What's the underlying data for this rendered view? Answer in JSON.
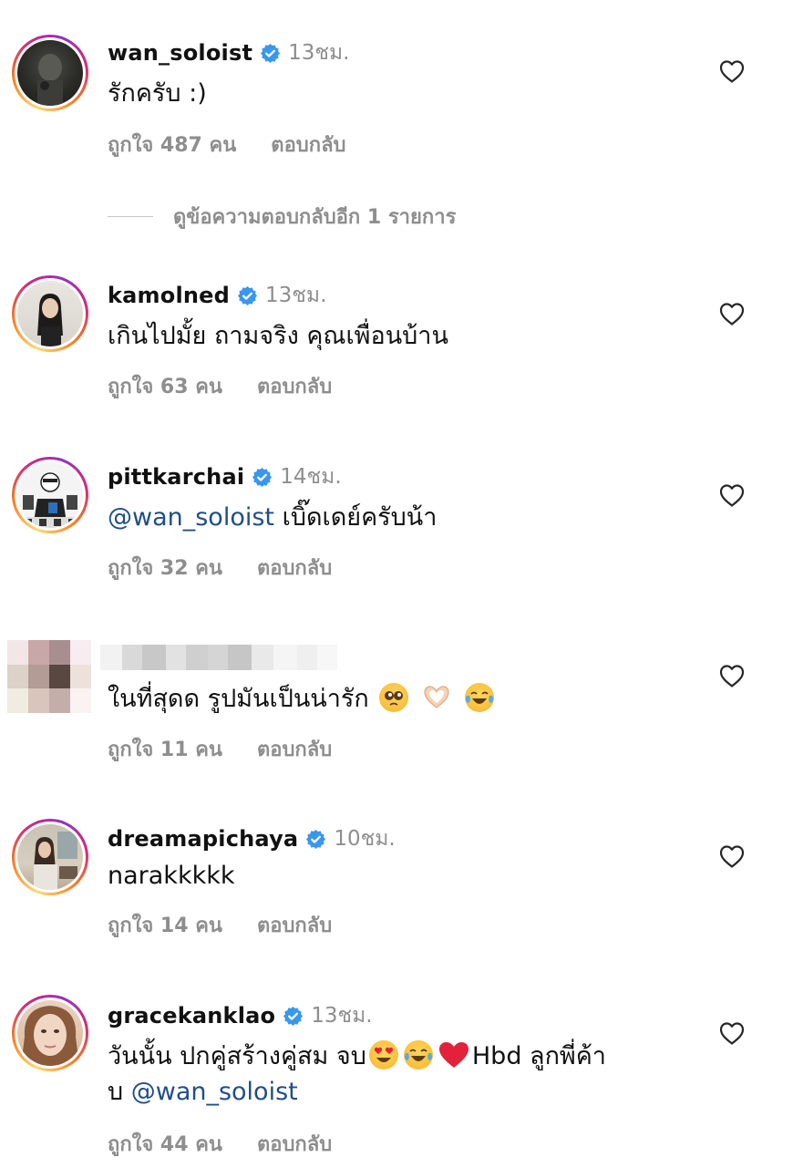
{
  "comments": [
    {
      "username": "wan_soloist",
      "verified": true,
      "time": "13ชม.",
      "text": "รักครับ :)",
      "likes": "ถูกใจ 487 คน",
      "reply": "ตอบกลับ",
      "avatar_icon": "dark-portrait-avatar"
    },
    {
      "username": "kamolned",
      "verified": true,
      "time": "13ชม.",
      "text": "เกินไปมั้ย ถามจริง คุณเพื่อนบ้าน",
      "likes": "ถูกใจ 63 คน",
      "reply": "ตอบกลับ",
      "avatar_icon": "woman-portrait-avatar"
    },
    {
      "username": "pittkarchai",
      "verified": true,
      "time": "14ชม.",
      "mention": "@wan_soloist",
      "text": "เบิ๊ดเดย์ครับน้า",
      "likes": "ถูกใจ 32 คน",
      "reply": "ตอบกลับ",
      "avatar_icon": "cartoon-avatar"
    },
    {
      "username": "",
      "verified": false,
      "time": "",
      "text": "ในที่สุดด รูปมันเป็นน่ารัก",
      "emojis": [
        "pleading-face-emoji",
        "heart-hands-emoji",
        "tears-of-joy-emoji"
      ],
      "likes": "ถูกใจ 11 คน",
      "reply": "ตอบกลับ",
      "avatar_icon": "blurred-avatar"
    },
    {
      "username": "dreamapichaya",
      "verified": true,
      "time": "10ชม.",
      "text": "narakkkkk",
      "likes": "ถูกใจ 14 คน",
      "reply": "ตอบกลับ",
      "avatar_icon": "woman-room-avatar"
    },
    {
      "username": "gracekanklao",
      "verified": true,
      "time": "13ชม.",
      "text_line1": "วันนั้น ปกคู่สร้างคู่สม จบ",
      "text_line1_after": "Hbd ลูกพี่ค้า",
      "text_line2_prefix": "บ ",
      "mention": "@wan_soloist",
      "emojis": [
        "heart-eyes-emoji",
        "tears-of-joy-emoji",
        "red-heart-emoji"
      ],
      "likes": "ถูกใจ 44 คน",
      "reply": "ตอบกลับ",
      "avatar_icon": "woman-closeup-avatar"
    }
  ],
  "view_more_replies": "ดูข้อความตอบกลับอีก 1 รายการ",
  "colors": {
    "verified_blue": "#3897f0",
    "muted_gray": "#8e8e8e",
    "mention_blue": "#1f4e8a"
  }
}
